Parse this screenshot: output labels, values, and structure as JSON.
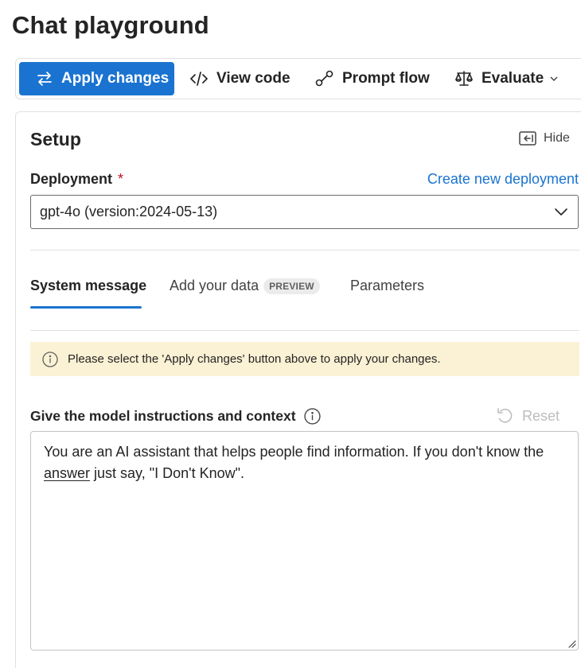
{
  "page": {
    "title": "Chat playground"
  },
  "toolbar": {
    "apply_label": "Apply changes",
    "view_code_label": "View code",
    "prompt_flow_label": "Prompt flow",
    "evaluate_label": "Evaluate"
  },
  "setup": {
    "title": "Setup",
    "hide_label": "Hide",
    "deployment_label": "Deployment",
    "required_mark": "*",
    "create_link": "Create new deployment",
    "deployment_value": "gpt-4o (version:2024-05-13)"
  },
  "tabs": {
    "system_message": "System message",
    "add_data": "Add your data",
    "preview_badge": "PREVIEW",
    "parameters": "Parameters",
    "active": "System message"
  },
  "notice": {
    "text": "Please select the 'Apply changes' button above to apply your changes."
  },
  "instructions": {
    "label": "Give the model instructions and context",
    "reset_label": "Reset",
    "text_before": "You are an AI assistant that helps people find information. If you don't know the ",
    "text_underlined": "answer",
    "text_after": " just say, \"I Don't Know\"."
  },
  "colors": {
    "accent": "#1a73d0",
    "notice_bg": "#fbf1d4",
    "required": "#c50f1f"
  }
}
